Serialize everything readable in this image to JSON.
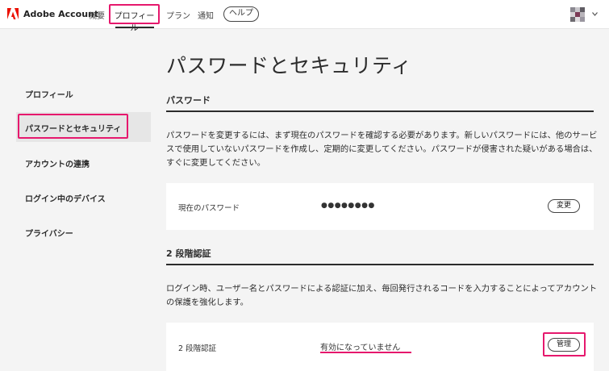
{
  "colors": {
    "accent": "#e6186d",
    "adobe_red": "#eb1000",
    "text": "#2c2c2c",
    "bg": "#f4f4f4"
  },
  "topbar": {
    "logo_icon": "adobe-logo-icon",
    "brand": "Adobe Account",
    "nav": [
      {
        "label": "概要"
      },
      {
        "label": "プロフィール",
        "active": true
      },
      {
        "label": "プラン"
      },
      {
        "label": "通知"
      }
    ],
    "help_label": "ヘルプ",
    "avatar_icon": "user-avatar",
    "menu_icon": "chevron-down-icon"
  },
  "sidebar": {
    "items": [
      {
        "label": "プロフィール"
      },
      {
        "label": "パスワードとセキュリティ",
        "active": true
      },
      {
        "label": "アカウントの連携"
      },
      {
        "label": "ログイン中のデバイス"
      },
      {
        "label": "プライバシー"
      }
    ]
  },
  "main": {
    "title": "パスワードとセキュリティ",
    "password": {
      "heading": "パスワード",
      "description": "パスワードを変更するには、まず現在のパスワードを確認する必要があります。新しいパスワードには、他のサービスで使用していないパスワードを作成し、定期的に変更してください。パスワードが侵害された疑いがある場合は、すぐに変更してください。",
      "card_label": "現在のパスワード",
      "masked_value": "●●●●●●●●",
      "change_button": "変更"
    },
    "two_factor": {
      "heading": "2 段階認証",
      "description": "ログイン時、ユーザー名とパスワードによる認証に加え、毎回発行されるコードを入力することによってアカウントの保護を強化します。",
      "card_label": "2 段階認証",
      "status": "有効になっていません",
      "manage_button": "管理"
    }
  }
}
